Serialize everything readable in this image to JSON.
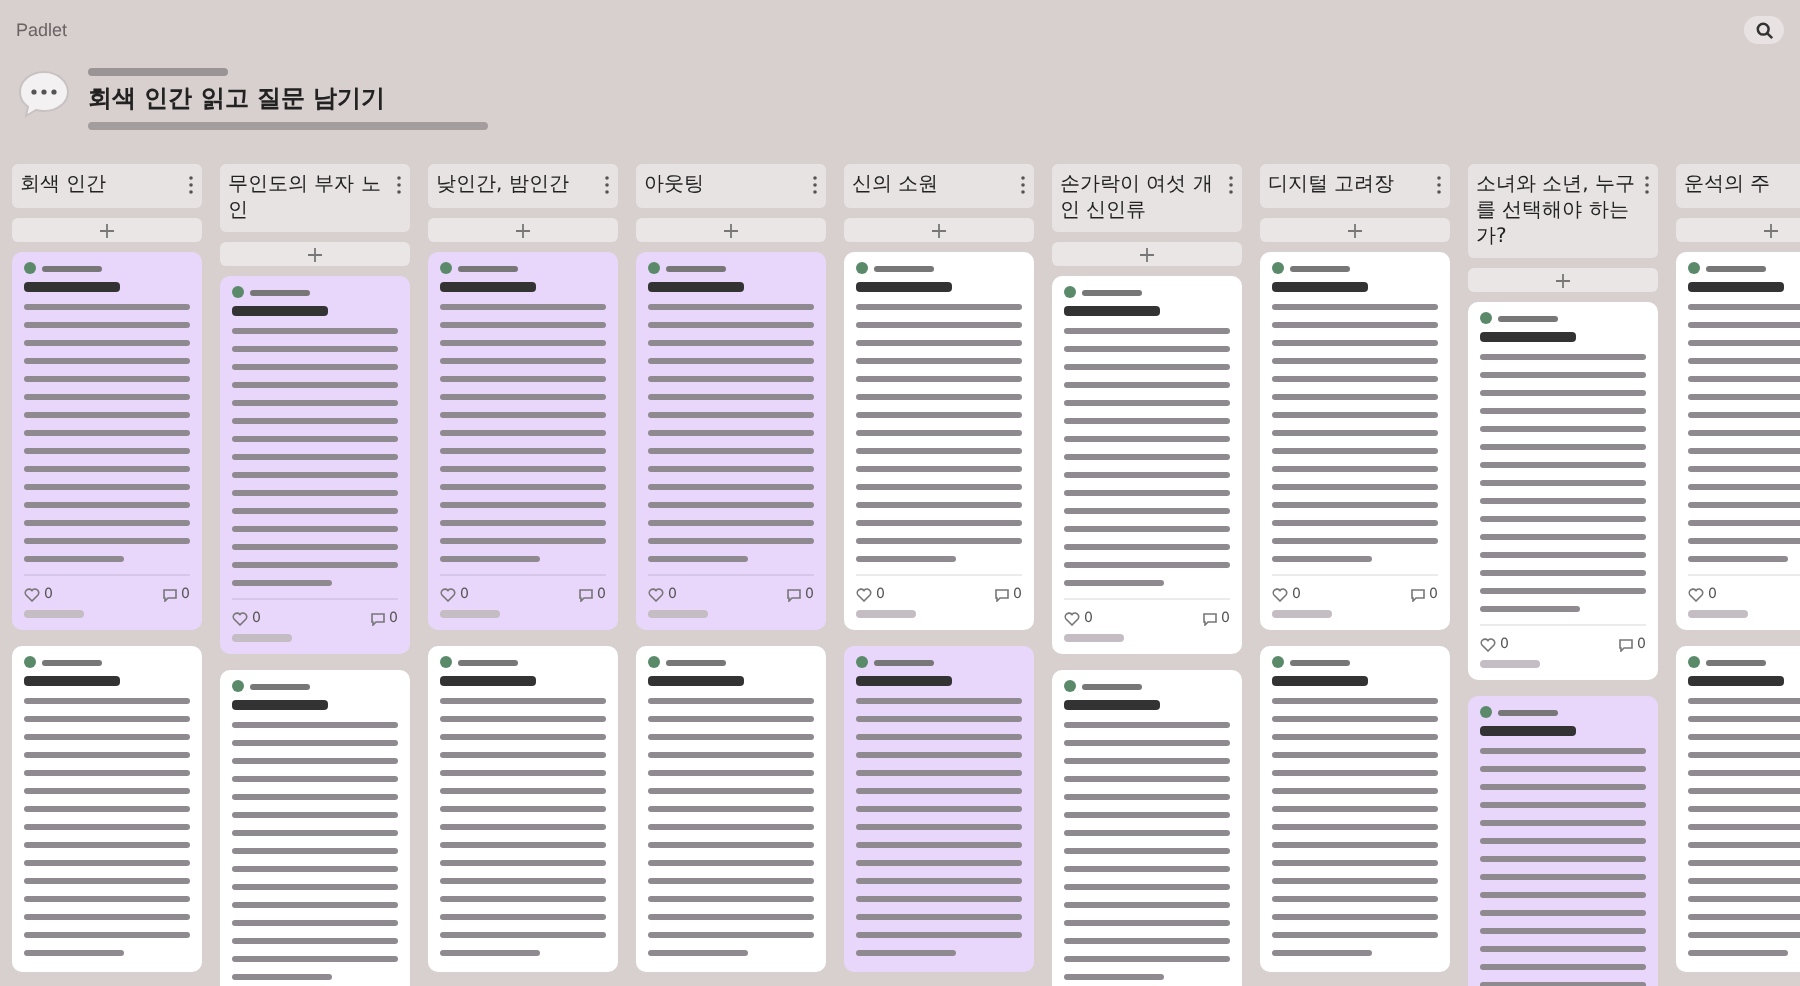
{
  "app": {
    "name": "Padlet"
  },
  "board": {
    "title": "회색 인간 읽고 질문 남기기"
  },
  "columns": [
    {
      "heading": "회색 인간",
      "cards": [
        {
          "color": "#e9d7fb",
          "likes": "0",
          "comments": "0"
        },
        {
          "color": "#ffffff"
        }
      ]
    },
    {
      "heading": "무인도의 부자 노인",
      "cards": [
        {
          "color": "#e9d7fb",
          "likes": "0",
          "comments": "0"
        },
        {
          "color": "#ffffff"
        }
      ]
    },
    {
      "heading": "낮인간, 밤인간",
      "cards": [
        {
          "color": "#e9d7fb",
          "likes": "0",
          "comments": "0"
        },
        {
          "color": "#ffffff"
        }
      ]
    },
    {
      "heading": "아웃팅",
      "cards": [
        {
          "color": "#e9d7fb",
          "likes": "0",
          "comments": "0"
        },
        {
          "color": "#ffffff"
        }
      ]
    },
    {
      "heading": "신의 소원",
      "cards": [
        {
          "color": "#ffffff",
          "likes": "0",
          "comments": "0"
        },
        {
          "color": "#e9d7fb"
        }
      ]
    },
    {
      "heading": "손가락이 여섯 개인 신인류",
      "cards": [
        {
          "color": "#ffffff",
          "likes": "0",
          "comments": "0"
        },
        {
          "color": "#ffffff"
        }
      ]
    },
    {
      "heading": "디지털 고려장",
      "cards": [
        {
          "color": "#ffffff",
          "likes": "0",
          "comments": "0"
        },
        {
          "color": "#ffffff"
        }
      ]
    },
    {
      "heading": "소녀와 소년, 누구를 선택해야 하는가?",
      "cards": [
        {
          "color": "#ffffff",
          "likes": "0",
          "comments": "0"
        },
        {
          "color": "#e9d7fb"
        }
      ]
    },
    {
      "heading": "운석의 주",
      "cards": [
        {
          "color": "#ffffff",
          "likes": "0"
        },
        {
          "color": "#ffffff"
        }
      ]
    }
  ]
}
